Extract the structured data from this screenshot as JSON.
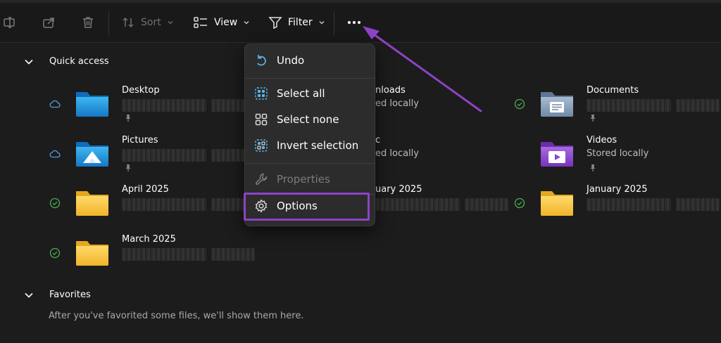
{
  "toolbar": {
    "sort_label": "Sort",
    "view_label": "View",
    "filter_label": "Filter"
  },
  "quick_access": {
    "label": "Quick access",
    "items": [
      {
        "name": "Desktop",
        "subtitle": ""
      },
      {
        "name": "Pictures",
        "subtitle": ""
      },
      {
        "name": "April 2025",
        "subtitle": ""
      },
      {
        "name": "March 2025",
        "subtitle": ""
      },
      {
        "name": "nloads",
        "subtitle": "ed locally"
      },
      {
        "name": "c",
        "subtitle": "ed locally"
      },
      {
        "name": "uary 2025",
        "subtitle": ""
      },
      {
        "name": "Documents",
        "subtitle": ""
      },
      {
        "name": "Videos",
        "subtitle": "Stored locally"
      },
      {
        "name": "January 2025",
        "subtitle": ""
      }
    ]
  },
  "favorites": {
    "label": "Favorites",
    "empty_text": "After you've favorited some files, we'll show them here."
  },
  "menu": {
    "items": [
      {
        "label": "Undo",
        "icon": "undo-icon",
        "enabled": true
      },
      {
        "label": "Select all",
        "icon": "select-all-icon",
        "enabled": true
      },
      {
        "label": "Select none",
        "icon": "select-none-icon",
        "enabled": true
      },
      {
        "label": "Invert selection",
        "icon": "invert-selection-icon",
        "enabled": true
      },
      {
        "label": "Properties",
        "icon": "wrench-icon",
        "enabled": false
      },
      {
        "label": "Options",
        "icon": "gear-icon",
        "enabled": true
      }
    ]
  },
  "colors": {
    "background": "#1c1c1c",
    "menu_bg": "#2c2c2c",
    "highlight": "#8e42c6",
    "status_ok": "#4caf50",
    "cloud": "#4a9de0",
    "folder_yellow": "#f2c94c"
  }
}
